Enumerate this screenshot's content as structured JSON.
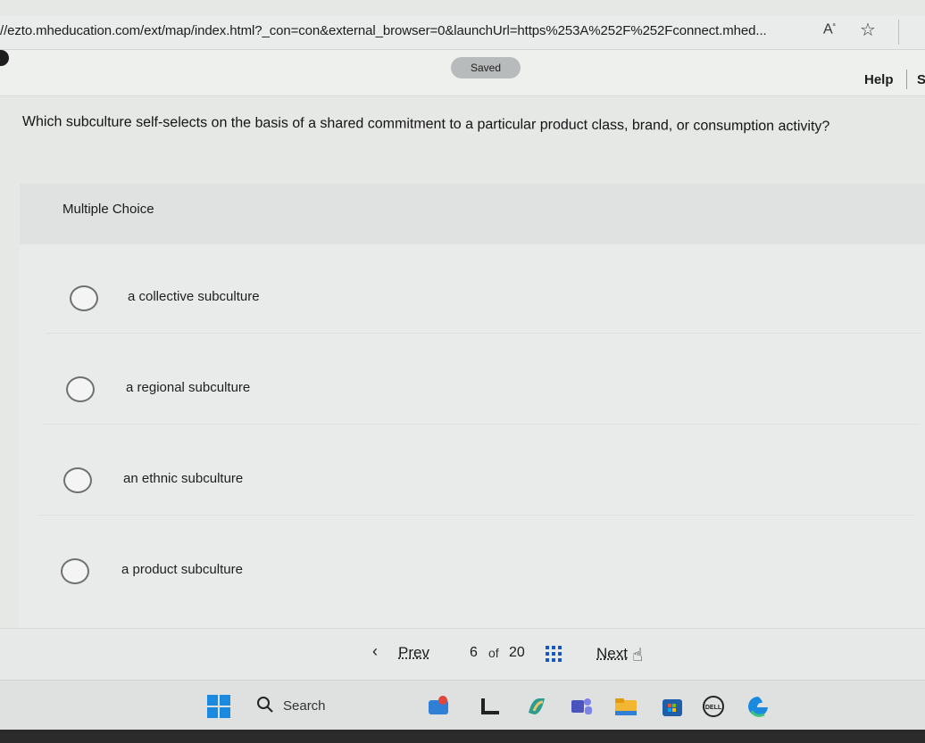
{
  "browser": {
    "url": "//ezto.mheducation.com/ext/map/index.html?_con=con&external_browser=0&launchUrl=https%253A%252F%252Fconnect.mhed...",
    "read_aloud_icon": "read-aloud-icon",
    "favorite_icon": "star-icon"
  },
  "header": {
    "saved_label": "Saved",
    "help_label": "Help",
    "cut_label": "S"
  },
  "question": {
    "text": "Which subculture self-selects on the basis of a shared commitment to a particular product class, brand, or consumption activity?"
  },
  "multiple_choice": {
    "label": "Multiple Choice",
    "options": [
      {
        "text": "a collective subculture"
      },
      {
        "text": "a regional subculture"
      },
      {
        "text": "an ethnic subculture"
      },
      {
        "text": "a product subculture"
      }
    ]
  },
  "pagination": {
    "prev_label": "Prev",
    "current": "6",
    "of_label": "of",
    "total": "20",
    "next_label": "Next"
  },
  "taskbar": {
    "search_label": "Search",
    "icons": [
      "windows-start-icon",
      "widgets-icon",
      "task-view-icon",
      "copilot-icon",
      "teams-icon",
      "file-explorer-icon",
      "store-icon",
      "dell-icon",
      "edge-icon"
    ]
  },
  "colors": {
    "accent_blue": "#1a56c4",
    "text_dark": "#1c1c1c"
  }
}
